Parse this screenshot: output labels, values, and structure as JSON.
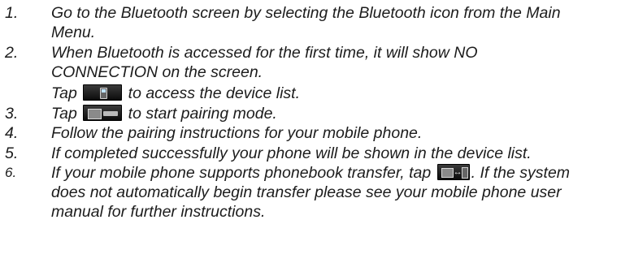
{
  "steps": [
    {
      "number": "1.",
      "lines": [
        "Go to the Bluetooth screen by selecting the Bluetooth icon from the Main",
        "Menu."
      ]
    },
    {
      "number": "2.",
      "lines": [
        "When Bluetooth is accessed for the first time, it will show NO",
        "CONNECTION on the screen."
      ],
      "tap_prefix": "Tap",
      "tap_suffix": "to access the device list.",
      "tap_icon": "phone-icon"
    },
    {
      "number": "3.",
      "tap_prefix": "Tap",
      "tap_suffix": "to start pairing mode.",
      "tap_icon": "new-device-icon"
    },
    {
      "number": "4.",
      "lines": [
        "Follow the pairing instructions for your mobile phone."
      ]
    },
    {
      "number": "5.",
      "lines": [
        "If completed successfully your phone will be shown in the device list."
      ]
    },
    {
      "number": "6.",
      "first_prefix": "If your mobile phone supports phonebook transfer, tap",
      "first_suffix": ". If the system",
      "tap_icon": "phonebook-transfer-icon",
      "lines": [
        "does not automatically begin transfer please see your mobile phone user",
        "manual for further instructions."
      ]
    }
  ]
}
